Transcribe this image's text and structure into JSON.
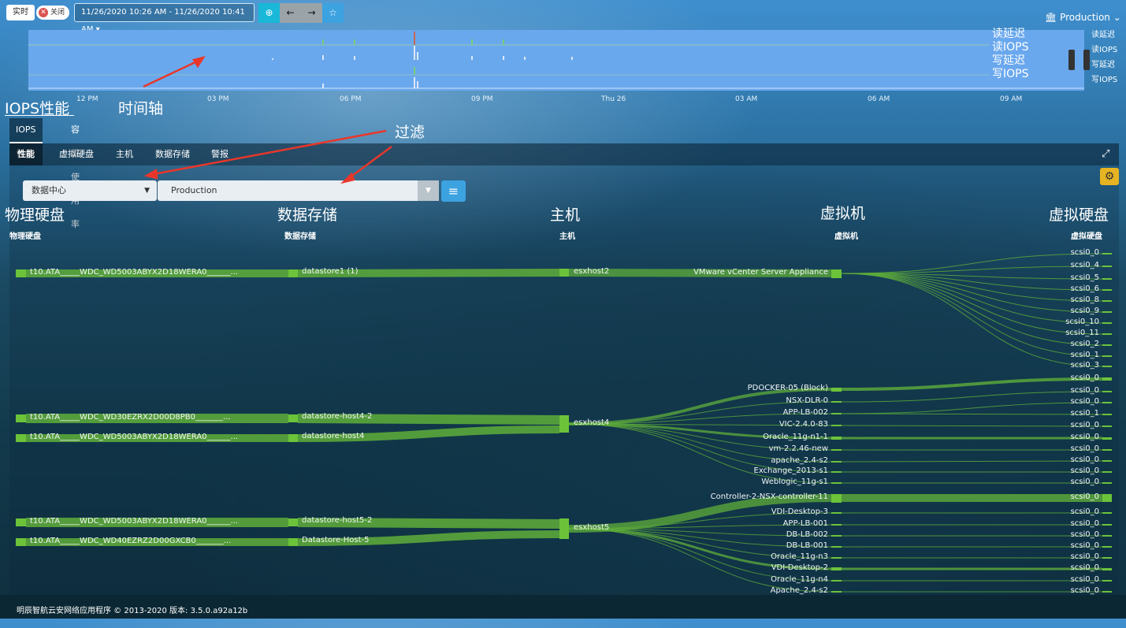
{
  "topbar": {
    "realtime_label": "实时",
    "toggle_label": "关闭",
    "time_range": "11/26/2020 10:26 AM - 11/26/2020 10:41 AM",
    "env_label": "Production"
  },
  "timeline": {
    "ticks": [
      "12 PM",
      "03 PM",
      "06 PM",
      "09 PM",
      "Thu 26",
      "03 AM",
      "06 AM",
      "09 AM"
    ],
    "legend_large": [
      "读延迟",
      "读IOPS",
      "写延迟",
      "写IOPS"
    ],
    "legend_small": [
      "读延迟",
      "读IOPS",
      "写延迟",
      "写IOPS"
    ]
  },
  "annotations": {
    "iops": "IOPS性能",
    "timeaxis": "时间轴",
    "filter": "过滤"
  },
  "tabs": [
    "IOPS性能",
    "容量使用率"
  ],
  "subtabs": [
    "性能",
    "虚拟硬盘",
    "主机",
    "数据存储",
    "警报"
  ],
  "filters": {
    "scope": "数据中心",
    "value": "Production"
  },
  "columns": {
    "big": [
      "物理硬盘",
      "数据存储",
      "主机",
      "虚拟机",
      "虚拟硬盘"
    ],
    "small": [
      "物理硬盘",
      "数据存储",
      "主机",
      "虚拟机",
      "虚拟硬盘"
    ]
  },
  "disks": [
    "t10.ATA_____WDC_WD5003ABYX2D18WERA0______...",
    "t10.ATA_____WDC_WD30EZRX2D00D8PB0_______...",
    "t10.ATA_____WDC_WD5003ABYX2D18WERA0______...",
    "t10.ATA_____WDC_WD5003ABYX2D18WERA0______...",
    "t10.ATA_____WDC_WD40EZRZ2D00GXCB0_______..."
  ],
  "datastores": [
    "datastore1 (1)",
    "datastore-host4-2",
    "datastore-host4",
    "datastore-host5-2",
    "Datastore-Host-5"
  ],
  "hosts": [
    "esxhost2",
    "esxhost4",
    "esxhost5"
  ],
  "vms": [
    "VMware vCenter Server Appliance",
    "PDOCKER-05 (Block)",
    "NSX-DLR-0",
    "APP-LB-002",
    "VIC-2.4.0-83",
    "Oracle_11g-n1-1",
    "vm-2.2.46-new",
    "apache_2.4-s2",
    "Exchange_2013-s1",
    "Weblogic_11g-s1",
    "Controller-2-NSX-controller-11",
    "VDI-Desktop-3",
    "APP-LB-001",
    "DB-LB-002",
    "DB-LB-001",
    "Oracle_11g-n3",
    "VDI-Desktop-2",
    "Oracle_11g-n4",
    "Apache_2.4-s2"
  ],
  "vdisks": [
    "scsi0_0",
    "scsi0_4",
    "scsi0_5",
    "scsi0_6",
    "scsi0_8",
    "scsi0_9",
    "scsi0_10",
    "scsi0_11",
    "scsi0_2",
    "scsi0_1",
    "scsi0_3",
    "scsi0_0",
    "scsi0_0",
    "scsi0_0",
    "scsi0_1",
    "scsi0_0",
    "scsi0_0",
    "scsi0_0",
    "scsi0_0",
    "scsi0_0",
    "scsi0_0",
    "scsi0_0",
    "scsi0_0",
    "scsi0_0",
    "scsi0_0",
    "scsi0_0",
    "scsi0_0",
    "scsi0_0",
    "scsi0_0",
    "scsi0_0"
  ],
  "footer": "明辰智航云安网络应用程序 © 2013-2020 版本: 3.5.0.a92a12b",
  "colors": {
    "flow": "#5fae3a",
    "node": "#6cc33a",
    "timeline": "#6aa8ee",
    "accent": "#3ca2e0"
  }
}
